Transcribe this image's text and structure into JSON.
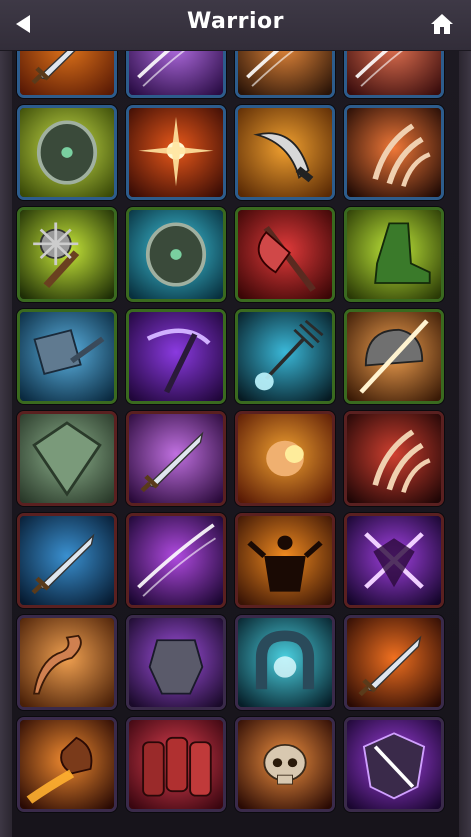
{
  "header": {
    "title": "Warrior",
    "back_icon": "back-arrow-icon",
    "home_icon": "home-icon",
    "bg": "#3a3540"
  },
  "skills": [
    {
      "icon": "sword-hilt-icon",
      "border": "#2d5c8c",
      "bg": [
        "#e0741a",
        "#5a1a05"
      ]
    },
    {
      "icon": "purple-slash-icon",
      "border": "#2d5c8c",
      "bg": [
        "#b06be0",
        "#2a0d45"
      ]
    },
    {
      "icon": "orange-swirl-icon",
      "border": "#2d5c8c",
      "bg": [
        "#e2863a",
        "#2a1408"
      ]
    },
    {
      "icon": "sword-tips-icon",
      "border": "#2d5c8c",
      "bg": [
        "#e07050",
        "#3a0d0d"
      ]
    },
    {
      "icon": "triple-shields-icon",
      "border": "#2d5c8c",
      "bg": [
        "#c9e04a",
        "#3a4a08"
      ]
    },
    {
      "icon": "orange-star-burst-icon",
      "border": "#2d5c8c",
      "bg": [
        "#e8581a",
        "#3a0c05"
      ]
    },
    {
      "icon": "curved-blade-icon",
      "border": "#2d5c8c",
      "bg": [
        "#f0a030",
        "#5a2a05"
      ]
    },
    {
      "icon": "claw-slash-icon",
      "border": "#2d5c8c",
      "bg": [
        "#f07838",
        "#200a05"
      ]
    },
    {
      "icon": "spiked-mace-icon",
      "border": "#3a6a1f",
      "bg": [
        "#c8e83a",
        "#1e2e06"
      ]
    },
    {
      "icon": "round-shield-icon",
      "border": "#3a6a1f",
      "bg": [
        "#40c8e0",
        "#08303e"
      ]
    },
    {
      "icon": "battle-axe-icon",
      "border": "#3a6a1f",
      "bg": [
        "#e03a3a",
        "#3a0606"
      ]
    },
    {
      "icon": "boot-icon",
      "border": "#3a6a1f",
      "bg": [
        "#c0e83a",
        "#2a3a06"
      ]
    },
    {
      "icon": "war-hammer-icon",
      "border": "#3a6a1f",
      "bg": [
        "#5ab0e0",
        "#0a2a40"
      ]
    },
    {
      "icon": "scythe-icon",
      "border": "#3a6a1f",
      "bg": [
        "#8a3ae0",
        "#20063a"
      ]
    },
    {
      "icon": "trident-icon",
      "border": "#3a6a1f",
      "bg": [
        "#3ab8d8",
        "#061a22"
      ]
    },
    {
      "icon": "helmet-slash-icon",
      "border": "#3a6a1f",
      "bg": [
        "#f0a050",
        "#3a1a06"
      ]
    },
    {
      "icon": "kite-shield-icon",
      "border": "#5a2020",
      "bg": [
        "#8cb08c",
        "#2a3a2a"
      ]
    },
    {
      "icon": "dark-blade-icon",
      "border": "#5a2020",
      "bg": [
        "#c070e0",
        "#2a0a3a"
      ]
    },
    {
      "icon": "fire-hand-icon",
      "border": "#5a2020",
      "bg": [
        "#f0a030",
        "#5a1a05"
      ]
    },
    {
      "icon": "beast-claw-icon",
      "border": "#5a2020",
      "bg": [
        "#d04030",
        "#200606"
      ]
    },
    {
      "icon": "sword-strike-icon",
      "border": "#5a2020",
      "bg": [
        "#3a90d0",
        "#061a30"
      ]
    },
    {
      "icon": "dagger-whirl-icon",
      "border": "#5a2020",
      "bg": [
        "#b04ae0",
        "#1a0630"
      ]
    },
    {
      "icon": "warrior-roar-icon",
      "border": "#5a2020",
      "bg": [
        "#f08a20",
        "#3a1405"
      ]
    },
    {
      "icon": "shield-cross-icon",
      "border": "#5a2020",
      "bg": [
        "#a040e0",
        "#14052a"
      ]
    },
    {
      "icon": "flexed-arm-icon",
      "border": "#3a2a4a",
      "bg": [
        "#f0a050",
        "#4a2008"
      ]
    },
    {
      "icon": "armor-icon",
      "border": "#3a2a4a",
      "bg": [
        "#a050e0",
        "#1a0a2a"
      ]
    },
    {
      "icon": "horseshoe-icon",
      "border": "#3a2a4a",
      "bg": [
        "#4ad0e0",
        "#061e28"
      ]
    },
    {
      "icon": "flaming-sword-icon",
      "border": "#3a2a4a",
      "bg": [
        "#f07020",
        "#2a0a04"
      ]
    },
    {
      "icon": "dragon-head-icon",
      "border": "#3a2a4a",
      "bg": [
        "#f08a30",
        "#2a0a04"
      ]
    },
    {
      "icon": "shield-wall-icon",
      "border": "#3a2a4a",
      "bg": [
        "#e04050",
        "#3a0610"
      ]
    },
    {
      "icon": "skull-icon",
      "border": "#3a2a4a",
      "bg": [
        "#f09040",
        "#2a0a04"
      ]
    },
    {
      "icon": "shield-break-icon",
      "border": "#3a2a4a",
      "bg": [
        "#a040e0",
        "#1a0630"
      ]
    }
  ]
}
